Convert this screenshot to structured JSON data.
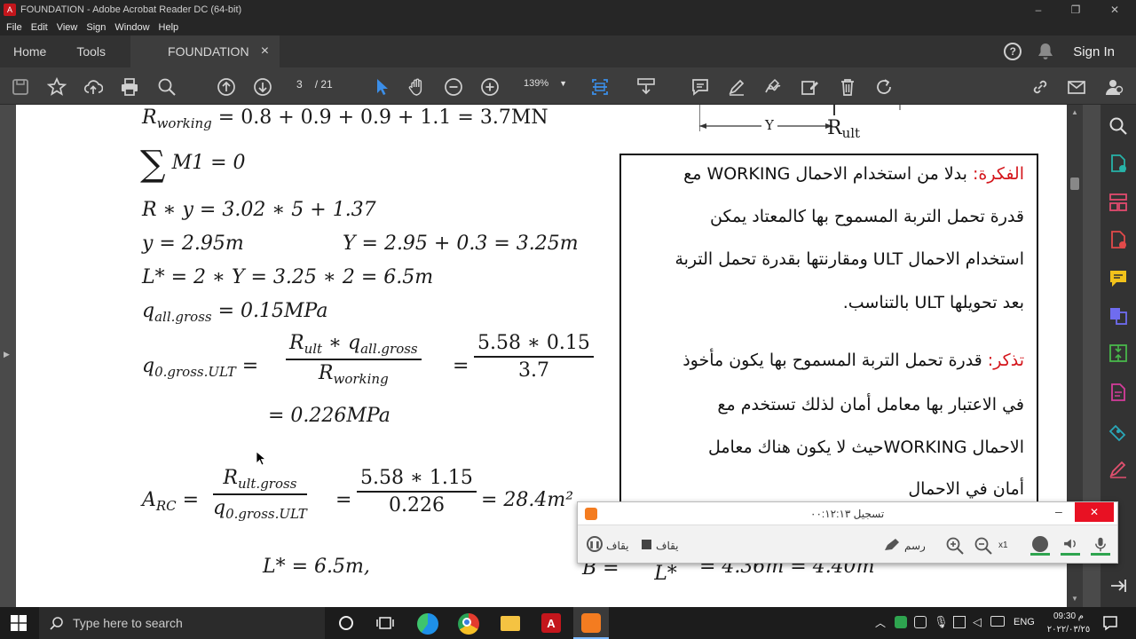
{
  "window": {
    "title": "FOUNDATION - Adobe Acrobat Reader DC (64-bit)",
    "minimize": "–",
    "restore": "❐",
    "close": "✕"
  },
  "menu": [
    "File",
    "Edit",
    "View",
    "Sign",
    "Window",
    "Help"
  ],
  "tabs": {
    "home": "Home",
    "tools": "Tools",
    "document": "FOUNDATION",
    "close": "×"
  },
  "header": {
    "help": "?",
    "sign_in": "Sign In"
  },
  "toolbar": {
    "page_current": "3",
    "page_total": "/ 21",
    "zoom": "139%"
  },
  "document": {
    "eq1": "= 0.8 + 0.9 + 0.9 + 1.1 = 3.7MN",
    "eq1_lhs": "R",
    "eq1_sub": "working",
    "eq2": "M1 = 0",
    "eq2_sigma": "∑",
    "eq3": "R ∗ y = 3.02 ∗ 5 + 1.37",
    "eq4a": "y = 2.95m",
    "eq4b": "Y = 2.95 + 0.3 = 3.25m",
    "eq5": "L* = 2 ∗ Y = 3.25 ∗ 2 = 6.5m",
    "eq6_lhs": "q",
    "eq6_sub": "all.gross",
    "eq6": "= 0.15MPa",
    "eq7_lhs": "q",
    "eq7_sub": "0.gross.ULT",
    "eq7_num_r": "R",
    "eq7_num_rsub": "ult",
    "eq7_num_q": " ∗ q",
    "eq7_num_qsub": "all.gross",
    "eq7_den_r": "R",
    "eq7_den_sub": "working",
    "eq7_num2": "5.58 ∗ 0.15",
    "eq7_den2": "3.7",
    "eq8": "= 0.226MPa",
    "eq9_lhs": "A",
    "eq9_sub": "RC",
    "eq9_num_r": "R",
    "eq9_num_sub": "ult.gross",
    "eq9_den_q": "q",
    "eq9_den_sub": "0.gross.ULT",
    "eq9_num2": "5.58 ∗ 1.15",
    "eq9_den2": "0.226",
    "eq9_result": "= 28.4m²",
    "eq10": "L* = 6.5m,",
    "eq11_lhs": "B",
    "eq11_den": "L*",
    "eq11_result": "= 4.36m = 4.40m",
    "fig_y": "Y",
    "fig_r": "R",
    "fig_rsub": "ult",
    "note": {
      "idea_label": "الفكرة:",
      "line1": "بدلا من استخدام الاحمال WORKING مع",
      "line2": "قدرة تحمل التربة المسموح بها كالمعتاد يمكن",
      "line3": "استخدام الاحمال ULT ومقارنتها بقدرة تحمل التربة",
      "line4": "بعد تحويلها ULT بالتناسب.",
      "remember_label": "تذكر:",
      "line5": "قدرة تحمل التربة المسموح بها يكون مأخوذ",
      "line6": "في الاعتبار بها معامل أمان لذلك تستخدم مع",
      "line7": "الاحمال WORKINGحيث لا يكون هناك معامل",
      "line8": "أمان في الاحمال"
    }
  },
  "recorder": {
    "title": "تسجيل ٠٠:١٢:١٣",
    "pause": "يقاف",
    "stop": "يقاف",
    "draw": "رسم",
    "speed": "x1"
  },
  "taskbar": {
    "search_placeholder": "Type here to search",
    "lang": "ENG",
    "time": "09:30 م",
    "date": "٢٠٢٢/٠٣/٢٥"
  },
  "colors": {
    "accent_red": "#d4151b",
    "recorder_red": "#e81123",
    "recorder_green": "#2ea44f"
  }
}
